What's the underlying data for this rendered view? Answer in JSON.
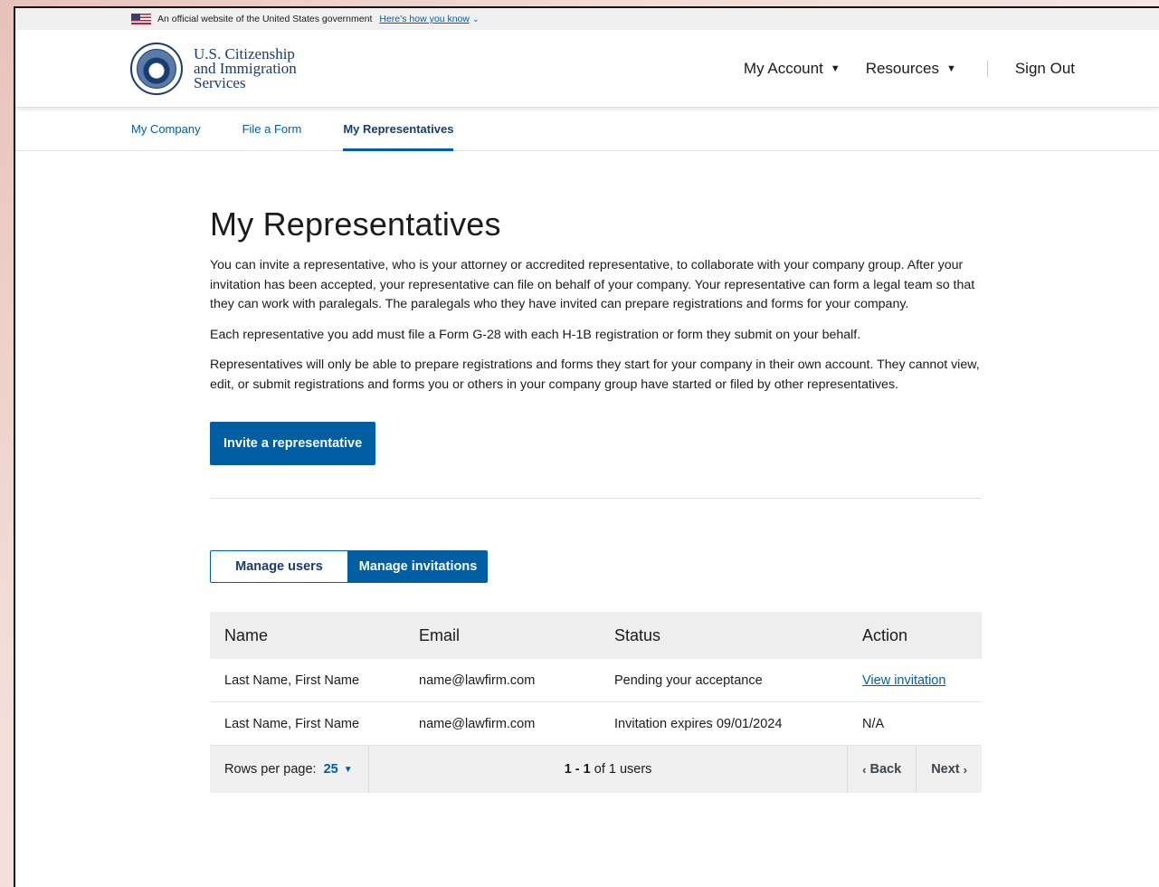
{
  "gov_banner": {
    "text": "An official website of the United States government",
    "link": "Here’s how you know",
    "chevron": "⌄"
  },
  "header": {
    "logo_line1": "U.S. Citizenship",
    "logo_line2": "and Immigration",
    "logo_line3": "Services",
    "nav": {
      "my_account": "My Account",
      "resources": "Resources",
      "sign_out": "Sign Out"
    }
  },
  "subnav": {
    "items": [
      "My Company",
      "File a Form",
      "My Representatives"
    ],
    "active": "My Representatives"
  },
  "main": {
    "title": "My Representatives",
    "paragraphs": [
      "You can invite a representative, who is your attorney or accredited representative, to collaborate with your company group. After your invitation has been accepted, your representative can file on behalf of your company. Your representative can form a legal team so that they can work with paralegals. The paralegals who they have invited can prepare registrations and forms for your company.",
      "Each representative you add must file a Form G-28 with each H-1B registration or form they submit on your behalf.",
      "Representatives will only be able to prepare registrations and forms they start for your company in their own account. They cannot view, edit, or submit registrations and forms you or others in your company group have started or filed by other representatives."
    ],
    "invite_button": "Invite a representative",
    "tabs": {
      "manage_users": "Manage users",
      "manage_invitations": "Manage invitations",
      "active": "Manage invitations"
    }
  },
  "table": {
    "headers": [
      "Name",
      "Email",
      "Status",
      "Action"
    ],
    "rows": [
      {
        "name": "Last Name, First Name",
        "email": "name@lawfirm.com",
        "status": "Pending your acceptance",
        "action": "View invitation"
      },
      {
        "name": "Last Name, First Name",
        "email": "name@lawfirm.com",
        "status": "Invitation expires 09/01/2024",
        "action": "N/A"
      }
    ]
  },
  "pagination": {
    "rows_label": "Rows per page:",
    "rows_value": "25",
    "range": "1 - 1",
    "of_text": "of 1 users",
    "back": "Back",
    "next": "Next"
  },
  "colors": {
    "primary": "#005ea2",
    "navy": "#1a3c6e",
    "header_bg": "#eeeeee"
  }
}
